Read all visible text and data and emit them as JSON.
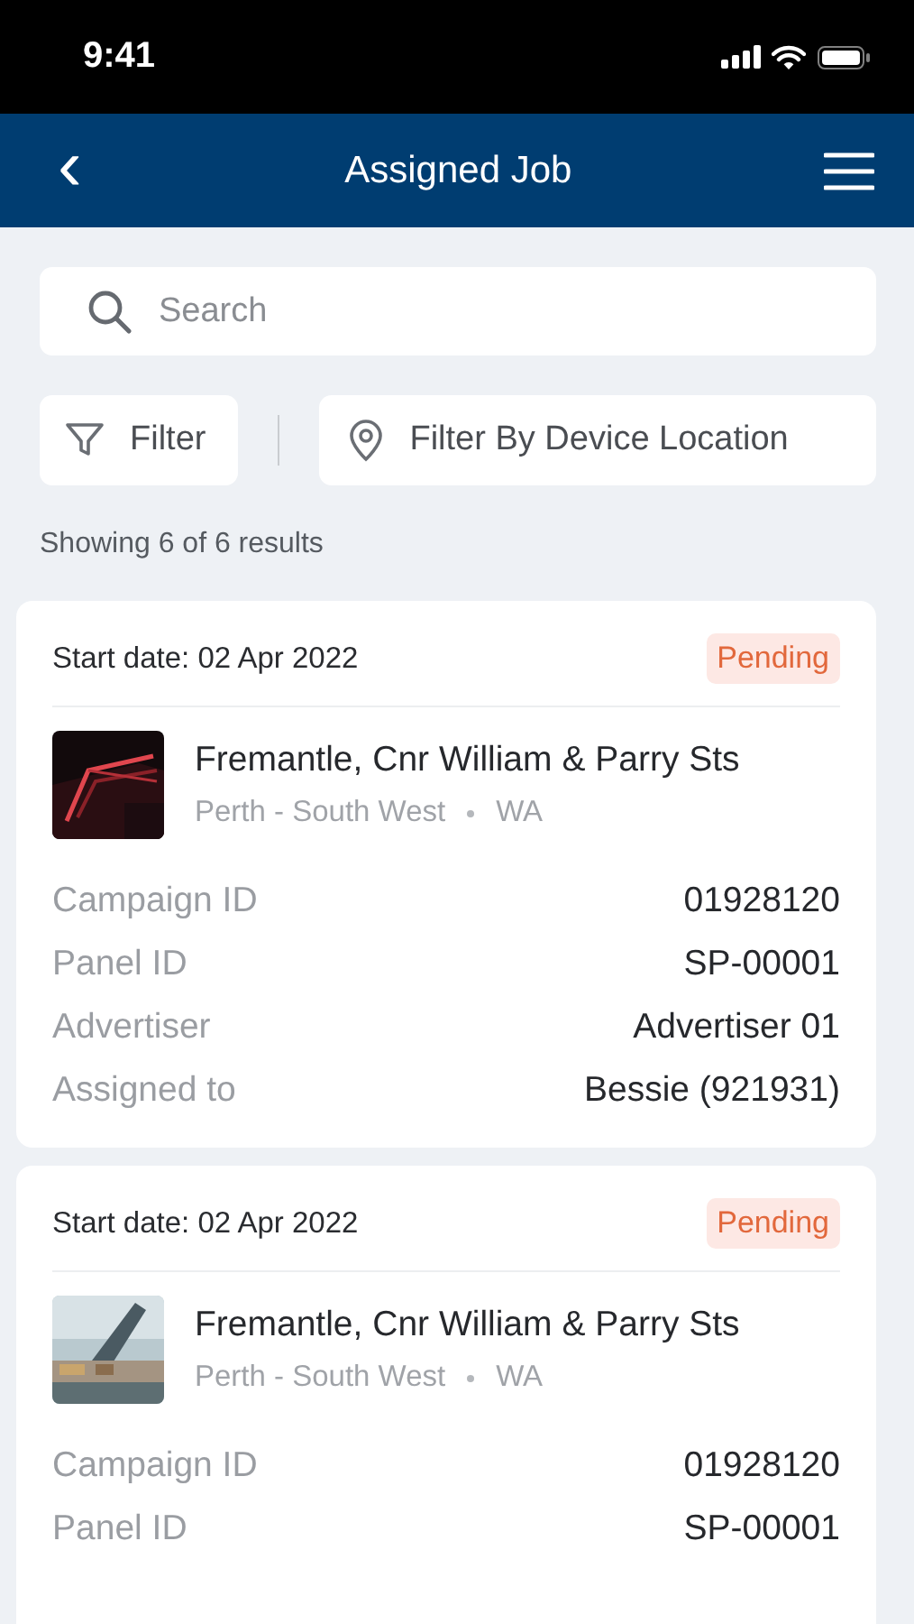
{
  "status_bar": {
    "time": "9:41"
  },
  "header": {
    "back": "‹",
    "title": "Assigned Job"
  },
  "search": {
    "placeholder": "Search"
  },
  "filters": [
    {
      "label": "Filter",
      "kind": "funnel"
    },
    {
      "label": "Filter By Device Location",
      "kind": "location"
    }
  ],
  "results_text": "Showing 6 of 6 results",
  "jobs": [
    {
      "start_date": "Start date: 02 Apr 2022",
      "status": "Pending",
      "title": "Fremantle, Cnr William & Parry Sts",
      "region": "Perth - South West",
      "state": "WA",
      "details": [
        {
          "label": "Campaign ID",
          "value": "01928120"
        },
        {
          "label": "Panel ID",
          "value": "SP-00001"
        },
        {
          "label": "Advertiser",
          "value": "Advertiser 01"
        },
        {
          "label": "Assigned to",
          "value": "Bessie (921931)"
        }
      ]
    },
    {
      "start_date": "Start date: 02 Apr 2022",
      "status": "Pending",
      "title": "Fremantle, Cnr William & Parry Sts",
      "region": "Perth - South West",
      "state": "WA",
      "details": [
        {
          "label": "Campaign ID",
          "value": "01928120"
        },
        {
          "label": "Panel ID",
          "value": "SP-00001"
        }
      ]
    }
  ]
}
